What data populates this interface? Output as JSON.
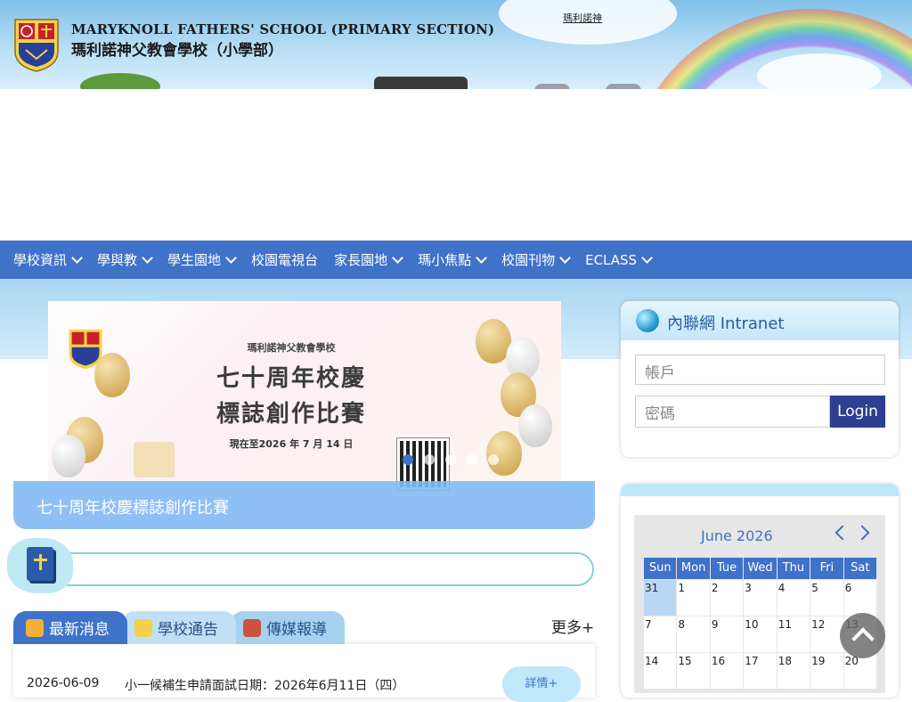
{
  "header": {
    "school_en": "MARYKNOLL FATHERS' SCHOOL (PRIMARY SECTION)",
    "school_zh": "瑪利諾神父教會學校（小學部）"
  },
  "nav": {
    "items": [
      {
        "label": "學校資訊",
        "dropdown": true
      },
      {
        "label": "學與教",
        "dropdown": true
      },
      {
        "label": "學生園地",
        "dropdown": true
      },
      {
        "label": "校園電視台",
        "dropdown": false
      },
      {
        "label": "家長園地",
        "dropdown": true
      },
      {
        "label": "瑪小焦點",
        "dropdown": true
      },
      {
        "label": "校園刊物",
        "dropdown": true
      },
      {
        "label": "ECLASS",
        "dropdown": true
      }
    ]
  },
  "slider": {
    "school": "瑪利諾神父教會學校",
    "title_line1": "七十周年校慶",
    "title_line2": "標誌創作比賽",
    "date_text": "現在至2026 年 7 月 14 日",
    "caption": "七十周年校慶標誌創作比賽",
    "dot_count": 5,
    "active_dot": 0
  },
  "marquee": {
    "text": "瑪利諾神"
  },
  "news": {
    "tabs": [
      "最新消息",
      "學校通告",
      "傳媒報導"
    ],
    "active_tab": 0,
    "more": "更多+",
    "items": [
      {
        "date": "2026-06-09",
        "title": "小一候補生申請面試日期：2026年6月11日（四）",
        "button": "詳情+"
      }
    ]
  },
  "intranet": {
    "title": "內聯網 Intranet",
    "account_placeholder": "帳戶",
    "password_placeholder": "密碼",
    "login_label": "Login"
  },
  "calendar": {
    "month": "June 2026",
    "weekdays": [
      "Sun",
      "Mon",
      "Tue",
      "Wed",
      "Thu",
      "Fri",
      "Sat"
    ],
    "days": [
      "31",
      "1",
      "2",
      "3",
      "4",
      "5",
      "6",
      "7",
      "8",
      "9",
      "10",
      "11",
      "12",
      "13",
      "14",
      "15",
      "16",
      "17",
      "18",
      "19",
      "20"
    ],
    "selected": "31"
  },
  "colors": {
    "nav_bg": "#3f72c9",
    "login_bg": "#2e3f91",
    "accent": "#3f72c9"
  },
  "icons": {
    "globe": "globe-icon",
    "back_to_top": "chevron-up-icon"
  }
}
